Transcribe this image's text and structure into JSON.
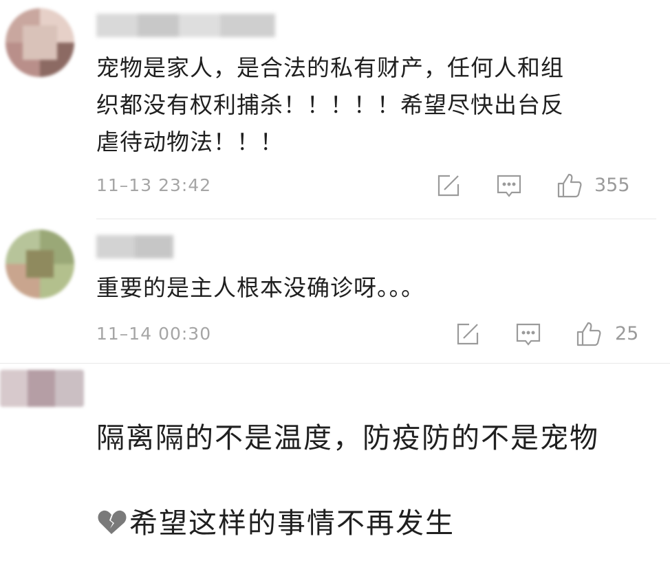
{
  "comments": [
    {
      "text": "宠物是家人，是合法的私有财产，任何人和组\n织都没有权利捕杀！！！！！希望尽快出台反\n虐待动物法！！！",
      "time": "11–13 23:42",
      "likes": "355",
      "icons": [
        "share-icon",
        "comment-icon",
        "like-icon"
      ]
    },
    {
      "text": "重要的是主人根本没确诊呀。。。",
      "time": "11–14 00:30",
      "likes": "25",
      "icons": [
        "share-icon",
        "comment-icon",
        "like-icon"
      ]
    },
    {
      "text_line1": "隔离隔的不是温度，防疫防的不是宠物",
      "text_line2": "希望这样的事情不再发生",
      "emoji": "broken-heart-icon"
    }
  ],
  "colors": {
    "text": "#1f1f1f",
    "meta": "#a5a5a5",
    "icon": "#9a9a9a",
    "divider": "#e8e8e8"
  }
}
